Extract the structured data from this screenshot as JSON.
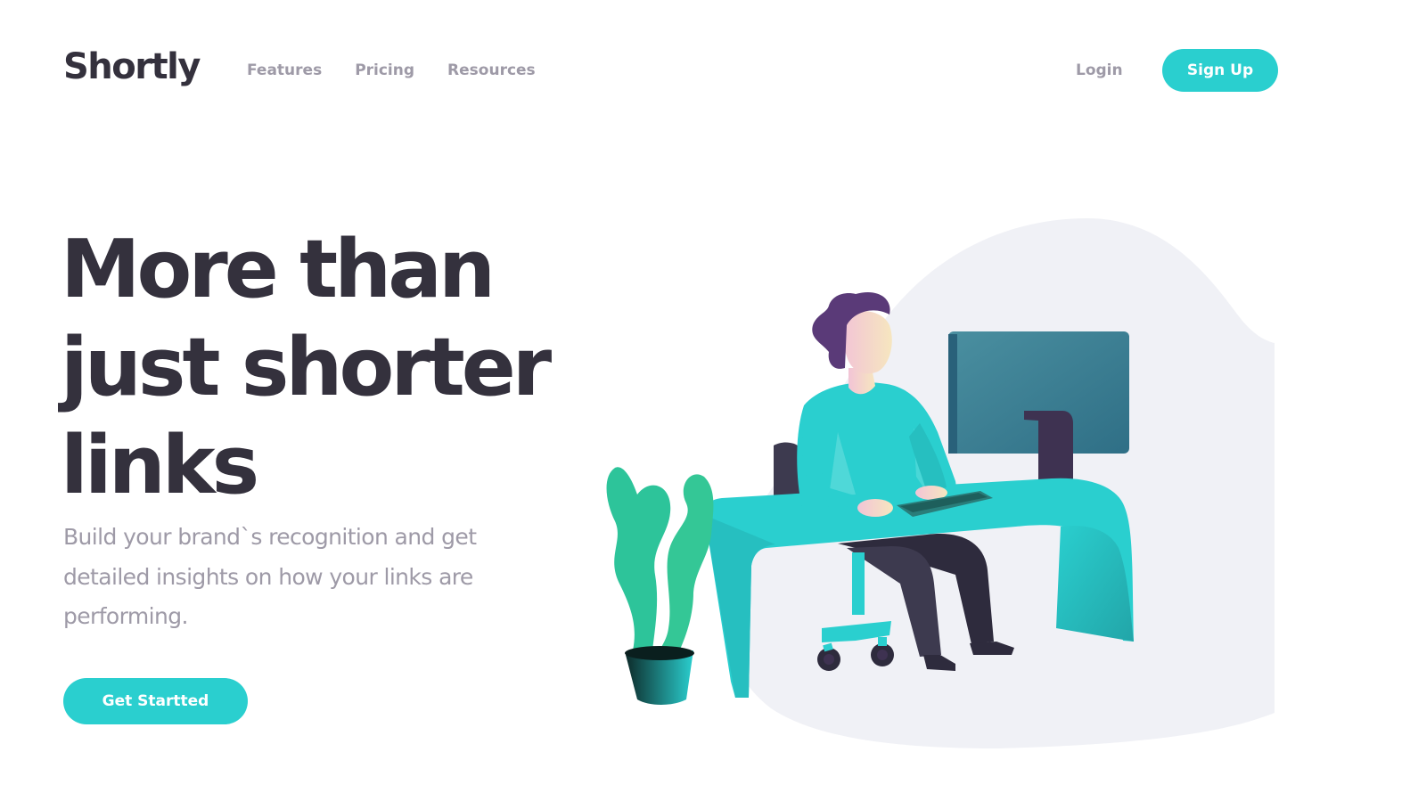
{
  "brand": {
    "name": "Shortly"
  },
  "nav": {
    "items": [
      {
        "label": "Features"
      },
      {
        "label": "Pricing"
      },
      {
        "label": "Resources"
      }
    ],
    "login_label": "Login",
    "signup_label": "Sign Up"
  },
  "hero": {
    "title": "More than just shorter links",
    "subtitle": "Build your brand`s recognition and get detailed insights on how your links are performing.",
    "cta_label": "Get Startted",
    "illustration_icon": "person-working-illustration"
  },
  "colors": {
    "accent": "#2acfcf",
    "dark_violet": "#3b3054",
    "heading": "#34313d",
    "muted_text": "#9e9aa7",
    "blob_background": "#f0f1f6"
  }
}
